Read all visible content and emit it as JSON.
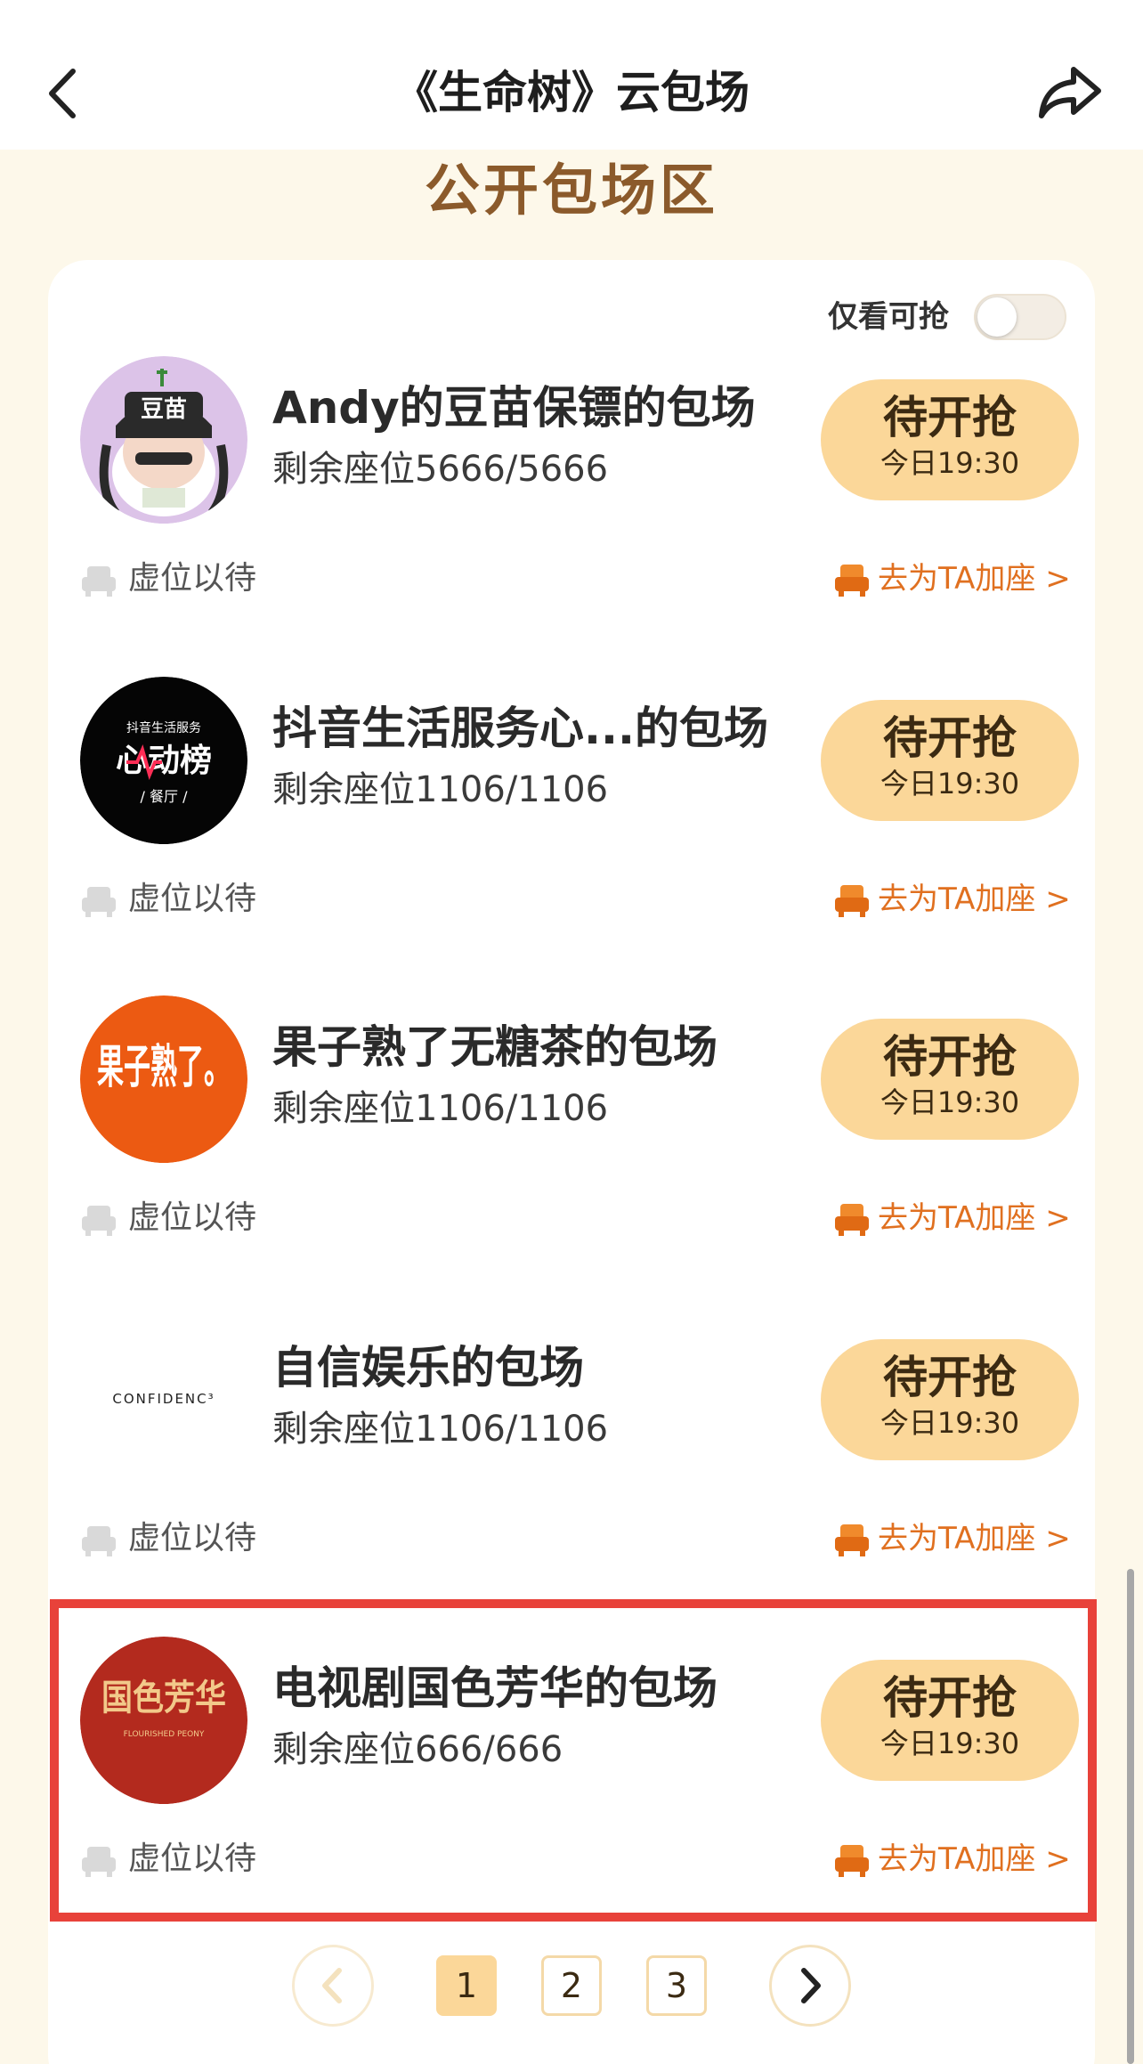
{
  "header": {
    "title": "《生命树》云包场",
    "back_icon": "chevron-left-icon",
    "share_icon": "share-arrow-icon"
  },
  "section": {
    "title": "公开包场区"
  },
  "filter": {
    "label": "仅看可抢",
    "toggle_on": false
  },
  "items": [
    {
      "name": "Andy的豆苗保镖的包场",
      "seats": "剩余座位5666/5666",
      "button_main": "待开抢",
      "button_time": "今日19:30",
      "wait_label": "虚位以待",
      "add_label": "去为TA加座 >",
      "avatar_icon": "cartoon-avatar-icon",
      "avatar_text": "豆苗"
    },
    {
      "name": "抖音生活服务心...的包场",
      "seats": "剩余座位1106/1106",
      "button_main": "待开抢",
      "button_time": "今日19:30",
      "wait_label": "虚位以待",
      "add_label": "去为TA加座 >",
      "avatar_icon": "douyin-heart-list-logo",
      "avatar_text": "心动榜",
      "avatar_sub": "抖音生活服务",
      "avatar_sub2": "/ 餐厅 /"
    },
    {
      "name": "果子熟了无糖茶的包场",
      "seats": "剩余座位1106/1106",
      "button_main": "待开抢",
      "button_time": "今日19:30",
      "wait_label": "虚位以待",
      "add_label": "去为TA加座 >",
      "avatar_icon": "guozishule-logo",
      "avatar_text": "果子熟了。"
    },
    {
      "name": "自信娱乐的包场",
      "seats": "剩余座位1106/1106",
      "button_main": "待开抢",
      "button_time": "今日19:30",
      "wait_label": "虚位以待",
      "add_label": "去为TA加座 >",
      "avatar_icon": "confidence-logo",
      "avatar_text": "CONFIDENC³"
    },
    {
      "name": "电视剧国色芳华的包场",
      "seats": "剩余座位666/666",
      "button_main": "待开抢",
      "button_time": "今日19:30",
      "wait_label": "虚位以待",
      "add_label": "去为TA加座 >",
      "avatar_icon": "guosefanghua-logo",
      "avatar_text": "国色芳华",
      "avatar_sub": "FLOURISHED PEONY"
    }
  ],
  "pagination": {
    "pages": [
      "1",
      "2",
      "3"
    ],
    "current": "1",
    "prev_icon": "chevron-left-icon",
    "next_icon": "chevron-right-icon"
  },
  "colors": {
    "accent": "#fbd799",
    "link": "#e07020",
    "title_brown": "#8b5a2b",
    "highlight": "#e8423a",
    "background": "#fdf8ea"
  }
}
